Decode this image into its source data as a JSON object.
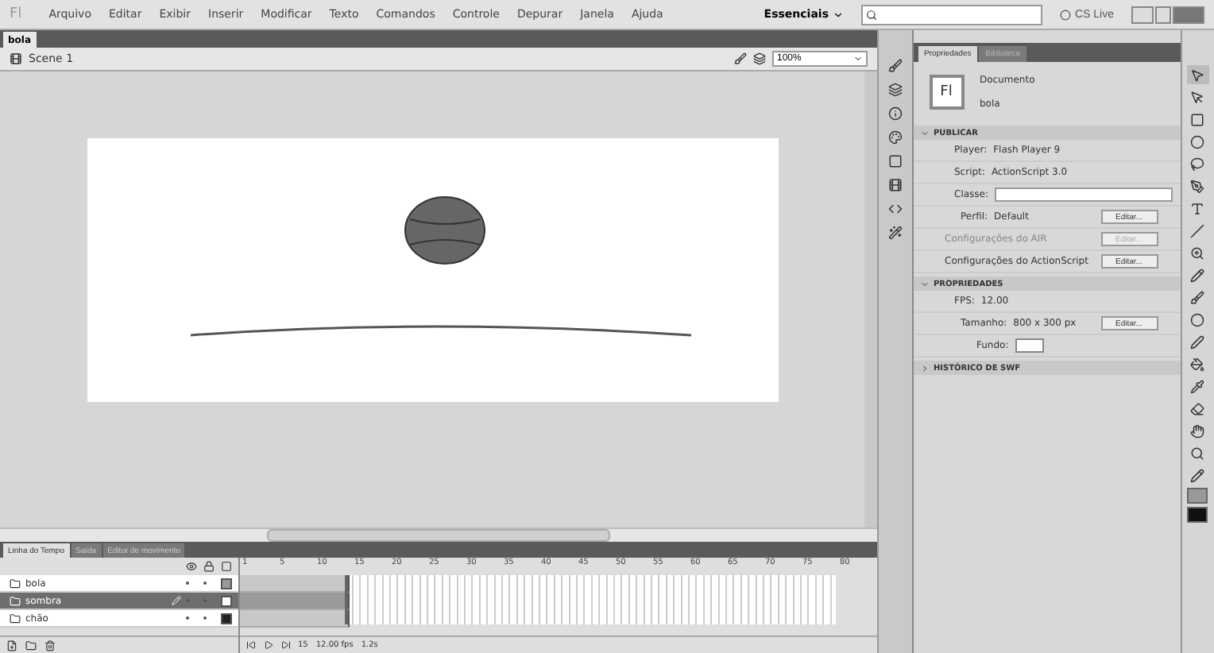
{
  "app_logo": "Fl",
  "menu": [
    "Arquivo",
    "Editar",
    "Exibir",
    "Inserir",
    "Modificar",
    "Texto",
    "Comandos",
    "Controle",
    "Depurar",
    "Janela",
    "Ajuda"
  ],
  "workspace": {
    "label": "Essenciais",
    "cs_live": "CS Live"
  },
  "document_tab": {
    "label": "bola",
    "selected": true
  },
  "scene": {
    "label": "Scene 1",
    "zoom": "100%"
  },
  "properties": {
    "tabs": [
      {
        "label": "Propriedades",
        "selected": true
      },
      {
        "label": "Biblioteca",
        "selected": false
      }
    ],
    "doc_icon": "Fl",
    "doc_type": "Documento",
    "doc_name": "bola",
    "sections": [
      {
        "title": "PUBLICAR",
        "expanded": true,
        "rows": [
          {
            "kind": "text",
            "label": "Player:",
            "value": "Flash Player 9"
          },
          {
            "kind": "text",
            "label": "Script:",
            "value": "ActionScript 3.0"
          },
          {
            "kind": "input",
            "label": "Classe:"
          },
          {
            "kind": "button",
            "label": "Perfil:",
            "value": "Default",
            "button": "Editar...",
            "disabled": false
          },
          {
            "kind": "button",
            "label": "Configurações do AIR",
            "button": "Editar...",
            "disabled": true
          },
          {
            "kind": "button",
            "label": "Configurações do ActionScript",
            "button": "Editar...",
            "disabled": false
          }
        ]
      },
      {
        "title": "PROPRIEDADES",
        "expanded": true,
        "rows": [
          {
            "kind": "text",
            "label": "FPS:",
            "value": "12.00"
          },
          {
            "kind": "button",
            "label": "Tamanho:",
            "value": "800 x 300 px",
            "button": "Editar...",
            "disabled": false
          },
          {
            "kind": "swatch",
            "label": "Fundo:",
            "color": "#ffffff"
          }
        ]
      },
      {
        "title": "HISTÓRICO DE SWF",
        "expanded": false
      }
    ]
  },
  "timeline": {
    "tabs": [
      {
        "label": "Linha do Tempo",
        "selected": true
      },
      {
        "label": "Saída",
        "selected": false
      },
      {
        "label": "Editor de movimento",
        "selected": false
      }
    ],
    "frame_numbers": [
      "1",
      "5",
      "10",
      "15",
      "20",
      "25",
      "30",
      "35",
      "40",
      "45",
      "50",
      "55",
      "60",
      "65",
      "70",
      "75",
      "80"
    ],
    "layers": [
      {
        "name": "bola",
        "selected": false
      },
      {
        "name": "sombra",
        "selected": true
      },
      {
        "name": "chão",
        "selected": false
      }
    ],
    "status": {
      "frame": "15",
      "fps": "12.00 fps",
      "time": "1.2s"
    }
  }
}
